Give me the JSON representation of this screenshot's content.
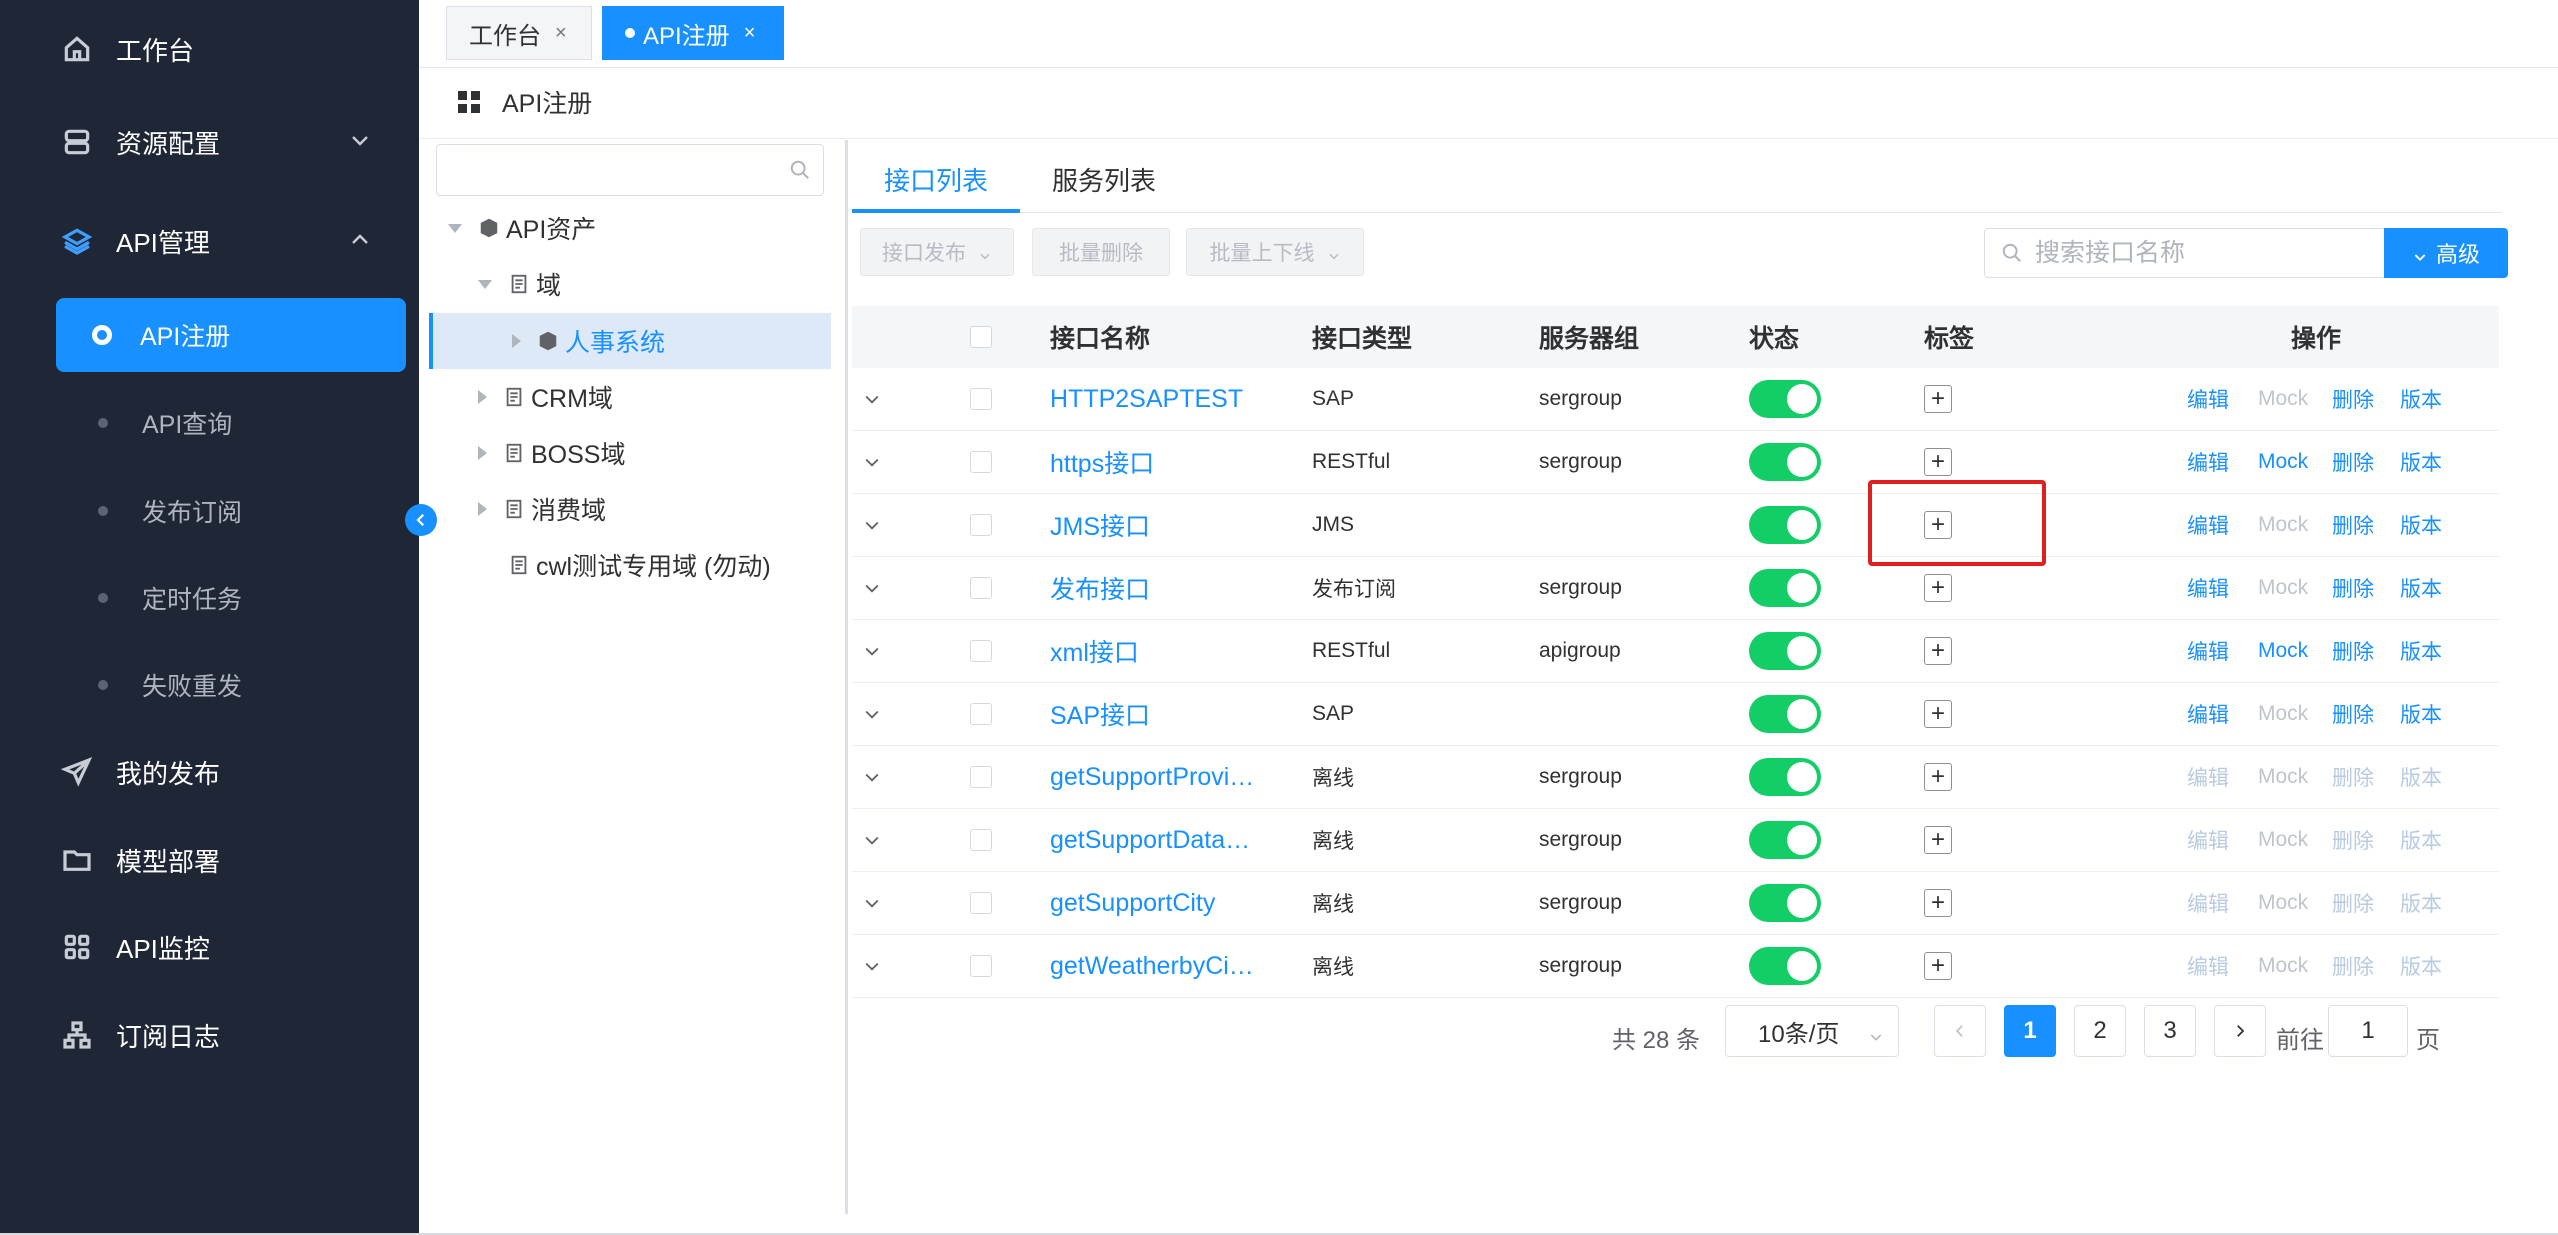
{
  "sidebar": {
    "items": [
      {
        "label": "工作台",
        "icon": "home-icon"
      },
      {
        "label": "资源配置",
        "icon": "server-icon"
      },
      {
        "label": "API管理",
        "icon": "layers-icon"
      },
      {
        "label": "我的发布",
        "icon": "send-icon"
      },
      {
        "label": "模型部署",
        "icon": "folder-icon"
      },
      {
        "label": "API监控",
        "icon": "grid-icon"
      },
      {
        "label": "订阅日志",
        "icon": "tree-icon"
      }
    ],
    "sub_items": [
      {
        "label": "API注册",
        "active": true
      },
      {
        "label": "API查询"
      },
      {
        "label": "发布订阅"
      },
      {
        "label": "定时任务"
      },
      {
        "label": "失败重发"
      }
    ]
  },
  "tabs": [
    {
      "label": "工作台",
      "close": "×"
    },
    {
      "label": "API注册",
      "close": "×",
      "active": true
    }
  ],
  "page_title": "API注册",
  "tree": {
    "search_placeholder": "",
    "nodes": [
      {
        "label": "API资产"
      },
      {
        "label": "域"
      },
      {
        "label": "人事系统",
        "selected": true
      },
      {
        "label": "CRM域"
      },
      {
        "label": "BOSS域"
      },
      {
        "label": "消费域"
      },
      {
        "label": "cwl测试专用域 (勿动)"
      }
    ]
  },
  "inner_tabs": [
    "接口列表",
    "服务列表"
  ],
  "toolbar": {
    "publish": "接口发布",
    "batch_delete": "批量删除",
    "batch_online": "批量上下线",
    "search_placeholder": "搜索接口名称",
    "advanced": "高级"
  },
  "table": {
    "headers": [
      "接口名称",
      "接口类型",
      "服务器组",
      "状态",
      "标签",
      "操作"
    ],
    "ops": [
      "编辑",
      "Mock",
      "删除",
      "版本"
    ],
    "rows": [
      {
        "name": "HTTP2SAPTEST",
        "type": "SAP",
        "group": "sergroup",
        "state": "on",
        "ops_style": [
          "enabled",
          "grey",
          "enabled",
          "enabled"
        ]
      },
      {
        "name": "https接口",
        "type": "RESTful",
        "group": "sergroup",
        "state": "on",
        "ops_style": [
          "enabled",
          "enabled",
          "enabled",
          "enabled"
        ]
      },
      {
        "name": "JMS接口",
        "type": "JMS",
        "group": "",
        "state": "on",
        "ops_style": [
          "enabled",
          "grey",
          "enabled",
          "enabled"
        ]
      },
      {
        "name": "发布接口",
        "type": "发布订阅",
        "group": "sergroup",
        "state": "on",
        "ops_style": [
          "enabled",
          "grey",
          "enabled",
          "enabled"
        ]
      },
      {
        "name": "xml接口",
        "type": "RESTful",
        "group": "apigroup",
        "state": "on",
        "ops_style": [
          "enabled",
          "enabled",
          "enabled",
          "enabled"
        ]
      },
      {
        "name": "SAP接口",
        "type": "SAP",
        "group": "",
        "state": "on",
        "ops_style": [
          "enabled",
          "grey",
          "enabled",
          "enabled"
        ]
      },
      {
        "name": "getSupportProvi…",
        "type": "离线",
        "group": "sergroup",
        "state": "on",
        "ops_style": [
          "disabled",
          "grey",
          "disabled",
          "disabled"
        ]
      },
      {
        "name": "getSupportData…",
        "type": "离线",
        "group": "sergroup",
        "state": "on",
        "ops_style": [
          "disabled",
          "grey",
          "disabled",
          "disabled"
        ]
      },
      {
        "name": "getSupportCity",
        "type": "离线",
        "group": "sergroup",
        "state": "on",
        "ops_style": [
          "disabled",
          "grey",
          "disabled",
          "disabled"
        ]
      },
      {
        "name": "getWeatherbyCi…",
        "type": "离线",
        "group": "sergroup",
        "state": "on",
        "ops_style": [
          "disabled",
          "grey",
          "disabled",
          "disabled"
        ]
      }
    ]
  },
  "pagination": {
    "total": "共 28 条",
    "page_size": "10条/页",
    "pages": [
      "1",
      "2",
      "3"
    ],
    "current": "1",
    "goto_prefix": "前往",
    "goto_value": "1",
    "goto_suffix": "页"
  },
  "colors": {
    "accent": "#1890ff",
    "sidebar_bg": "#1f2636",
    "switch_on": "#13ce66",
    "highlight": "#e02020"
  }
}
